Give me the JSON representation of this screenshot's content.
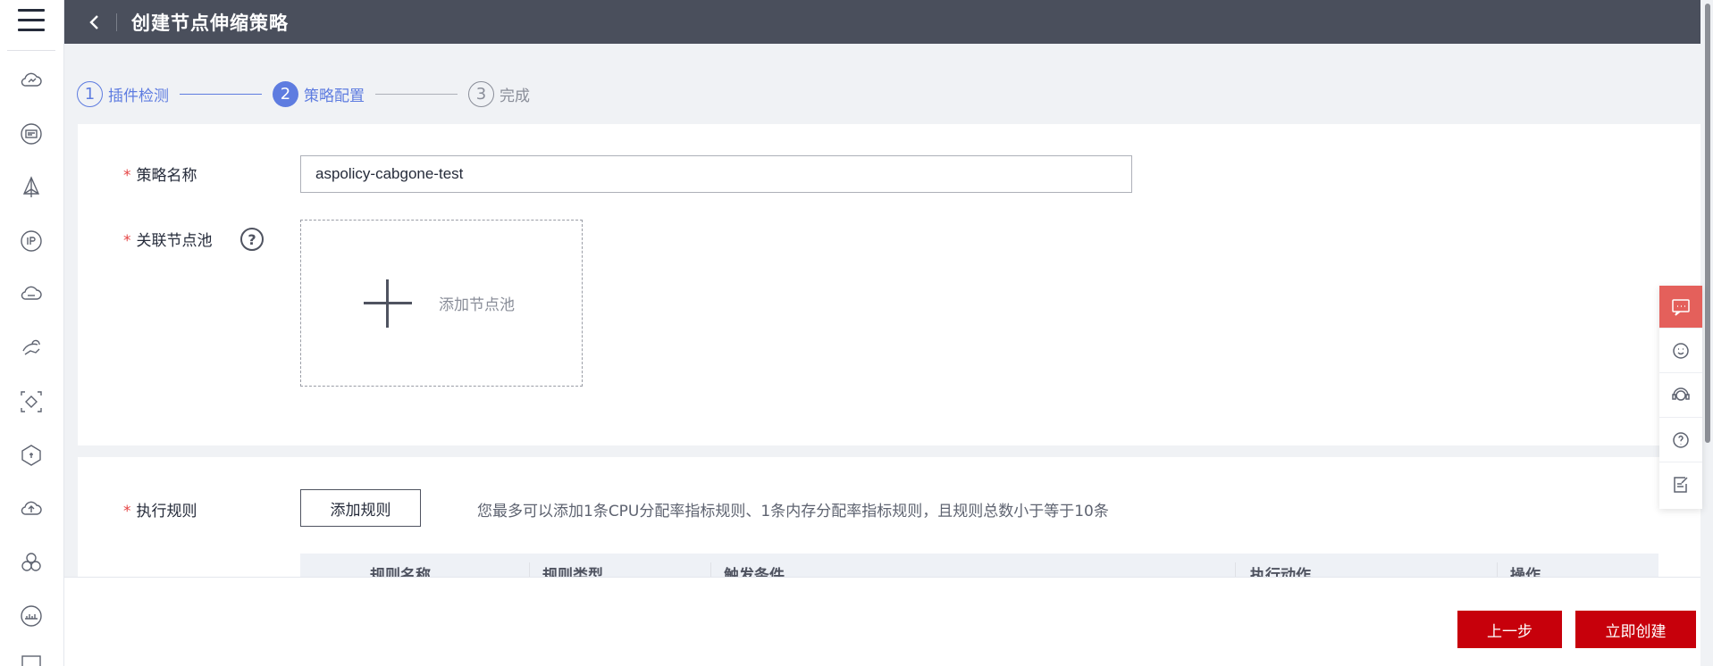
{
  "header": {
    "title": "创建节点伸缩策略"
  },
  "steps": [
    {
      "num": "1",
      "label": "插件检测"
    },
    {
      "num": "2",
      "label": "策略配置"
    },
    {
      "num": "3",
      "label": "完成"
    }
  ],
  "form": {
    "policy_name_label": "策略名称",
    "policy_name_value": "aspolicy-cabgone-test",
    "node_pool_label": "关联节点池",
    "help_glyph": "?",
    "add_node_pool_label": "添加节点池",
    "rules_label": "执行规则",
    "add_rule_button": "添加规则",
    "rules_hint": "您最多可以添加1条CPU分配率指标规则、1条内存分配率指标规则，且规则总数小于等于10条",
    "required_mark": "*"
  },
  "table": {
    "columns": [
      "规则名称",
      "规则类型",
      "触发条件",
      "执行动作",
      "操作"
    ]
  },
  "footer": {
    "prev_button": "上一步",
    "create_button": "立即创建"
  },
  "colors": {
    "accent": "#5e7ce0",
    "primary_button": "#c7000b",
    "header_bg": "#4a4f5c",
    "required": "#e54545"
  },
  "icons": {
    "rail": [
      "menu-icon",
      "cloud-service-icon",
      "ecs-icon",
      "cce-icon",
      "eip-icon",
      "cloud-icon",
      "hand-cloud-icon",
      "diamond-icon",
      "package-icon",
      "upload-cloud-icon",
      "cluster-icon",
      "network-icon",
      "monitor-icon"
    ],
    "float": [
      "chat-icon",
      "smile-icon",
      "headset-icon",
      "question-icon",
      "feedback-icon"
    ]
  }
}
